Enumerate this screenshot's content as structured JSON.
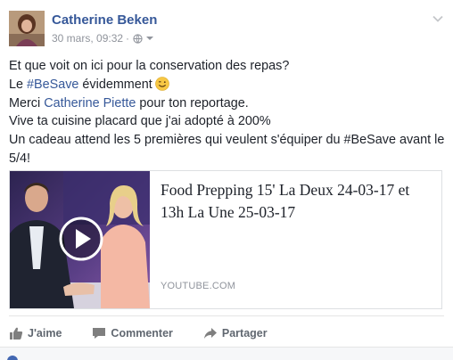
{
  "post": {
    "author": "Catherine Beken",
    "timestamp": "30 mars, 09:32",
    "separator": "·",
    "privacy_icon": "globe-icon",
    "body": {
      "line1": "Et que voit on ici pour la conservation des repas?",
      "line2_prefix": "Le ",
      "line2_hashtag": "#BeSave",
      "line2_suffix": " évidemment",
      "line3_prefix": "Merci ",
      "line3_mention": "Catherine Piette",
      "line3_suffix": " pour ton reportage.",
      "line4": "Vive ta cuisine placard que j'ai adopté à 200%",
      "line5": "Un cadeau attend les 5 premières qui veulent s'équiper du #BeSave avant le",
      "line6": "5/4!"
    },
    "link_card": {
      "title": "Food Prepping 15' La Deux 24-03-17 et 13h La Une 25-03-17",
      "domain": "YOUTUBE.COM"
    },
    "actions": {
      "like": "J'aime",
      "comment": "Commenter",
      "share": "Partager"
    }
  },
  "colors": {
    "link": "#365899",
    "text": "#1d2129",
    "muted": "#90949c",
    "action": "#606770"
  }
}
